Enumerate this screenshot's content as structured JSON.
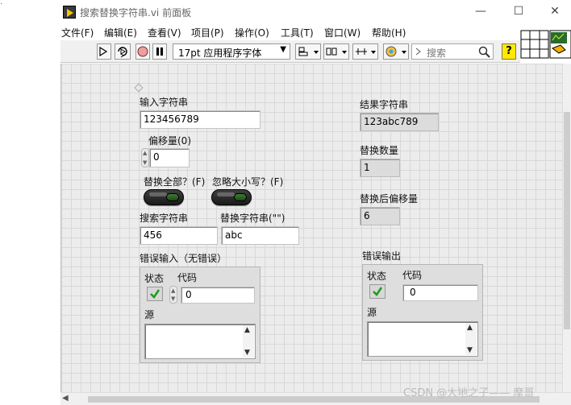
{
  "window": {
    "title": "搜索替换字符串.vi 前面板",
    "minimize": "—",
    "maximize": "☐",
    "close": "✕"
  },
  "menu": [
    "文件(F)",
    "编辑(E)",
    "查看(V)",
    "项目(P)",
    "操作(O)",
    "工具(T)",
    "窗口(W)",
    "帮助(H)"
  ],
  "toolbar": {
    "font": "17pt 应用程序字体",
    "search_placeholder": "搜索",
    "help": "?"
  },
  "controls": {
    "input_string": {
      "label": "输入字符串",
      "value": "123456789"
    },
    "offset": {
      "label": "偏移量(0)",
      "value": "0"
    },
    "replace_all": {
      "label": "替换全部？(F)"
    },
    "ignore_case": {
      "label": "忽略大小写？(F)"
    },
    "search_string": {
      "label": "搜索字符串",
      "value": "456"
    },
    "replace_string": {
      "label": "替换字符串(\"\")",
      "value": "abc"
    },
    "error_in": {
      "label": "错误输入（无错误）",
      "status_label": "状态",
      "code_label": "代码",
      "code_value": "0",
      "source_label": "源",
      "source_value": ""
    }
  },
  "indicators": {
    "result_string": {
      "label": "结果字符串",
      "value": "123abc789"
    },
    "replace_count": {
      "label": "替换数量",
      "value": "1"
    },
    "offset_past": {
      "label": "替换后偏移量",
      "value": "6"
    },
    "error_out": {
      "label": "错误输出",
      "status_label": "状态",
      "code_label": "代码",
      "code_value": "0",
      "source_label": "源",
      "source_value": ""
    }
  },
  "watermark": "CSDN @大地之子—— 摩哥",
  "colors": {
    "help_button": "#ffe900",
    "toggle_led": "#2e6b27",
    "check_green": "#1f9a1f"
  }
}
